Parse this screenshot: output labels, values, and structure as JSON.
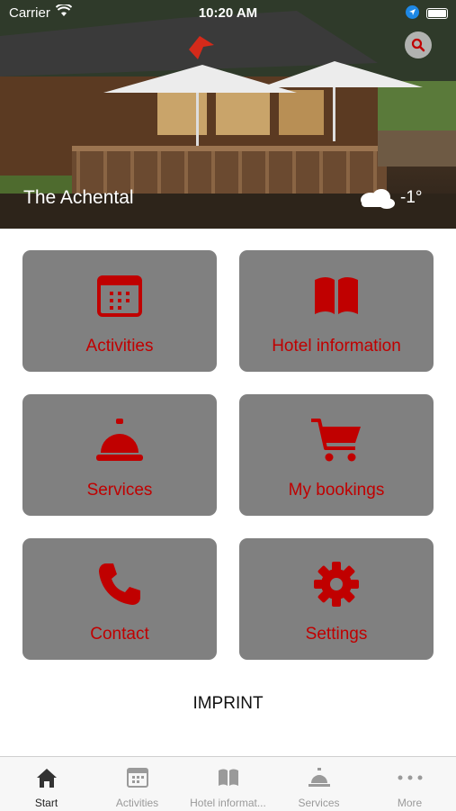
{
  "status_bar": {
    "carrier": "Carrier",
    "time": "10:20 AM"
  },
  "hero": {
    "title": "The Achental",
    "temperature": "-1°"
  },
  "tiles": [
    {
      "label": "Activities",
      "icon": "calendar-icon"
    },
    {
      "label": "Hotel information",
      "icon": "book-icon"
    },
    {
      "label": "Services",
      "icon": "service-bell-icon"
    },
    {
      "label": "My bookings",
      "icon": "cart-icon"
    },
    {
      "label": "Contact",
      "icon": "phone-icon"
    },
    {
      "label": "Settings",
      "icon": "gear-icon"
    }
  ],
  "imprint_label": "IMPRINT",
  "tab_bar": [
    {
      "label": "Start",
      "icon": "home-icon",
      "active": true
    },
    {
      "label": "Activities",
      "icon": "calendar-icon",
      "active": false
    },
    {
      "label": "Hotel informat...",
      "icon": "book-icon",
      "active": false
    },
    {
      "label": "Services",
      "icon": "service-bell-icon",
      "active": false
    },
    {
      "label": "More",
      "icon": "more-dots-icon",
      "active": false
    }
  ],
  "colors": {
    "accent": "#c00000",
    "tile_bg": "#808080",
    "tab_active": "#222222",
    "tab_inactive": "#9a9a9a"
  }
}
